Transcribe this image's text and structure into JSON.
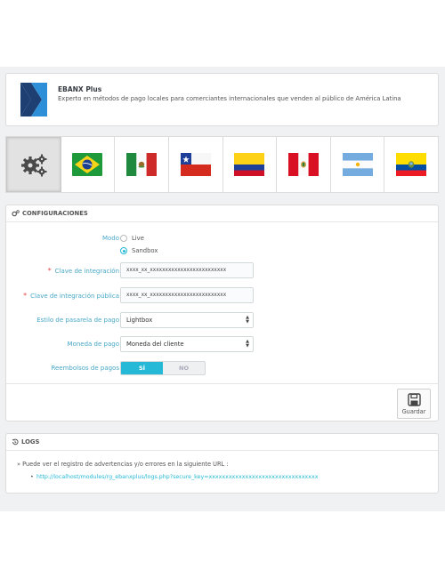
{
  "header": {
    "title": "EBANX Plus",
    "description": "Experto en métodos de pago locales para comerciantes internacionales que venden al público de América Latina"
  },
  "tabs": [
    {
      "icon": "gears-icon",
      "label": ""
    },
    {
      "icon": "brazil-flag-icon"
    },
    {
      "icon": "mexico-flag-icon"
    },
    {
      "icon": "chile-flag-icon"
    },
    {
      "icon": "colombia-flag-icon"
    },
    {
      "icon": "peru-flag-icon"
    },
    {
      "icon": "argentina-flag-icon"
    },
    {
      "icon": "ecuador-flag-icon"
    }
  ],
  "config": {
    "title": "CONFIGURACIONES",
    "modo_label": "Modo",
    "modo_options": [
      "Live",
      "Sandbox"
    ],
    "modo_selected": "Sandbox",
    "clave_label": "Clave de integración",
    "clave_value": "xxxx_xx_xxxxxxxxxxxxxxxxxxxxxxxxx",
    "clave_publica_label": "Clave de integración pública",
    "clave_publica_value": "xxxx_xx_xxxxxxxxxxxxxxxxxxxxxxxxx",
    "required_mark": "*",
    "estilo_label": "Estilo de pasarela de pago",
    "estilo_value": "Lightbox",
    "moneda_label": "Moneda de pago",
    "moneda_value": "Moneda del cliente",
    "reembolsos_label": "Reembolsos de pagos",
    "reembolsos_on": "SÍ",
    "reembolsos_off": "NO",
    "save_label": "Guardar",
    "accent_color": "#25b9d7"
  },
  "logs": {
    "title": "LOGS",
    "text": "» Puede ver el registro de advertencias y/o errores en la siguiente URL :",
    "bullet": "•",
    "url": "http://localhost/modules/rg_ebanxplus/logs.php?secure_key=xxxxxxxxxxxxxxxxxxxxxxxxxxxxxxxxx"
  }
}
